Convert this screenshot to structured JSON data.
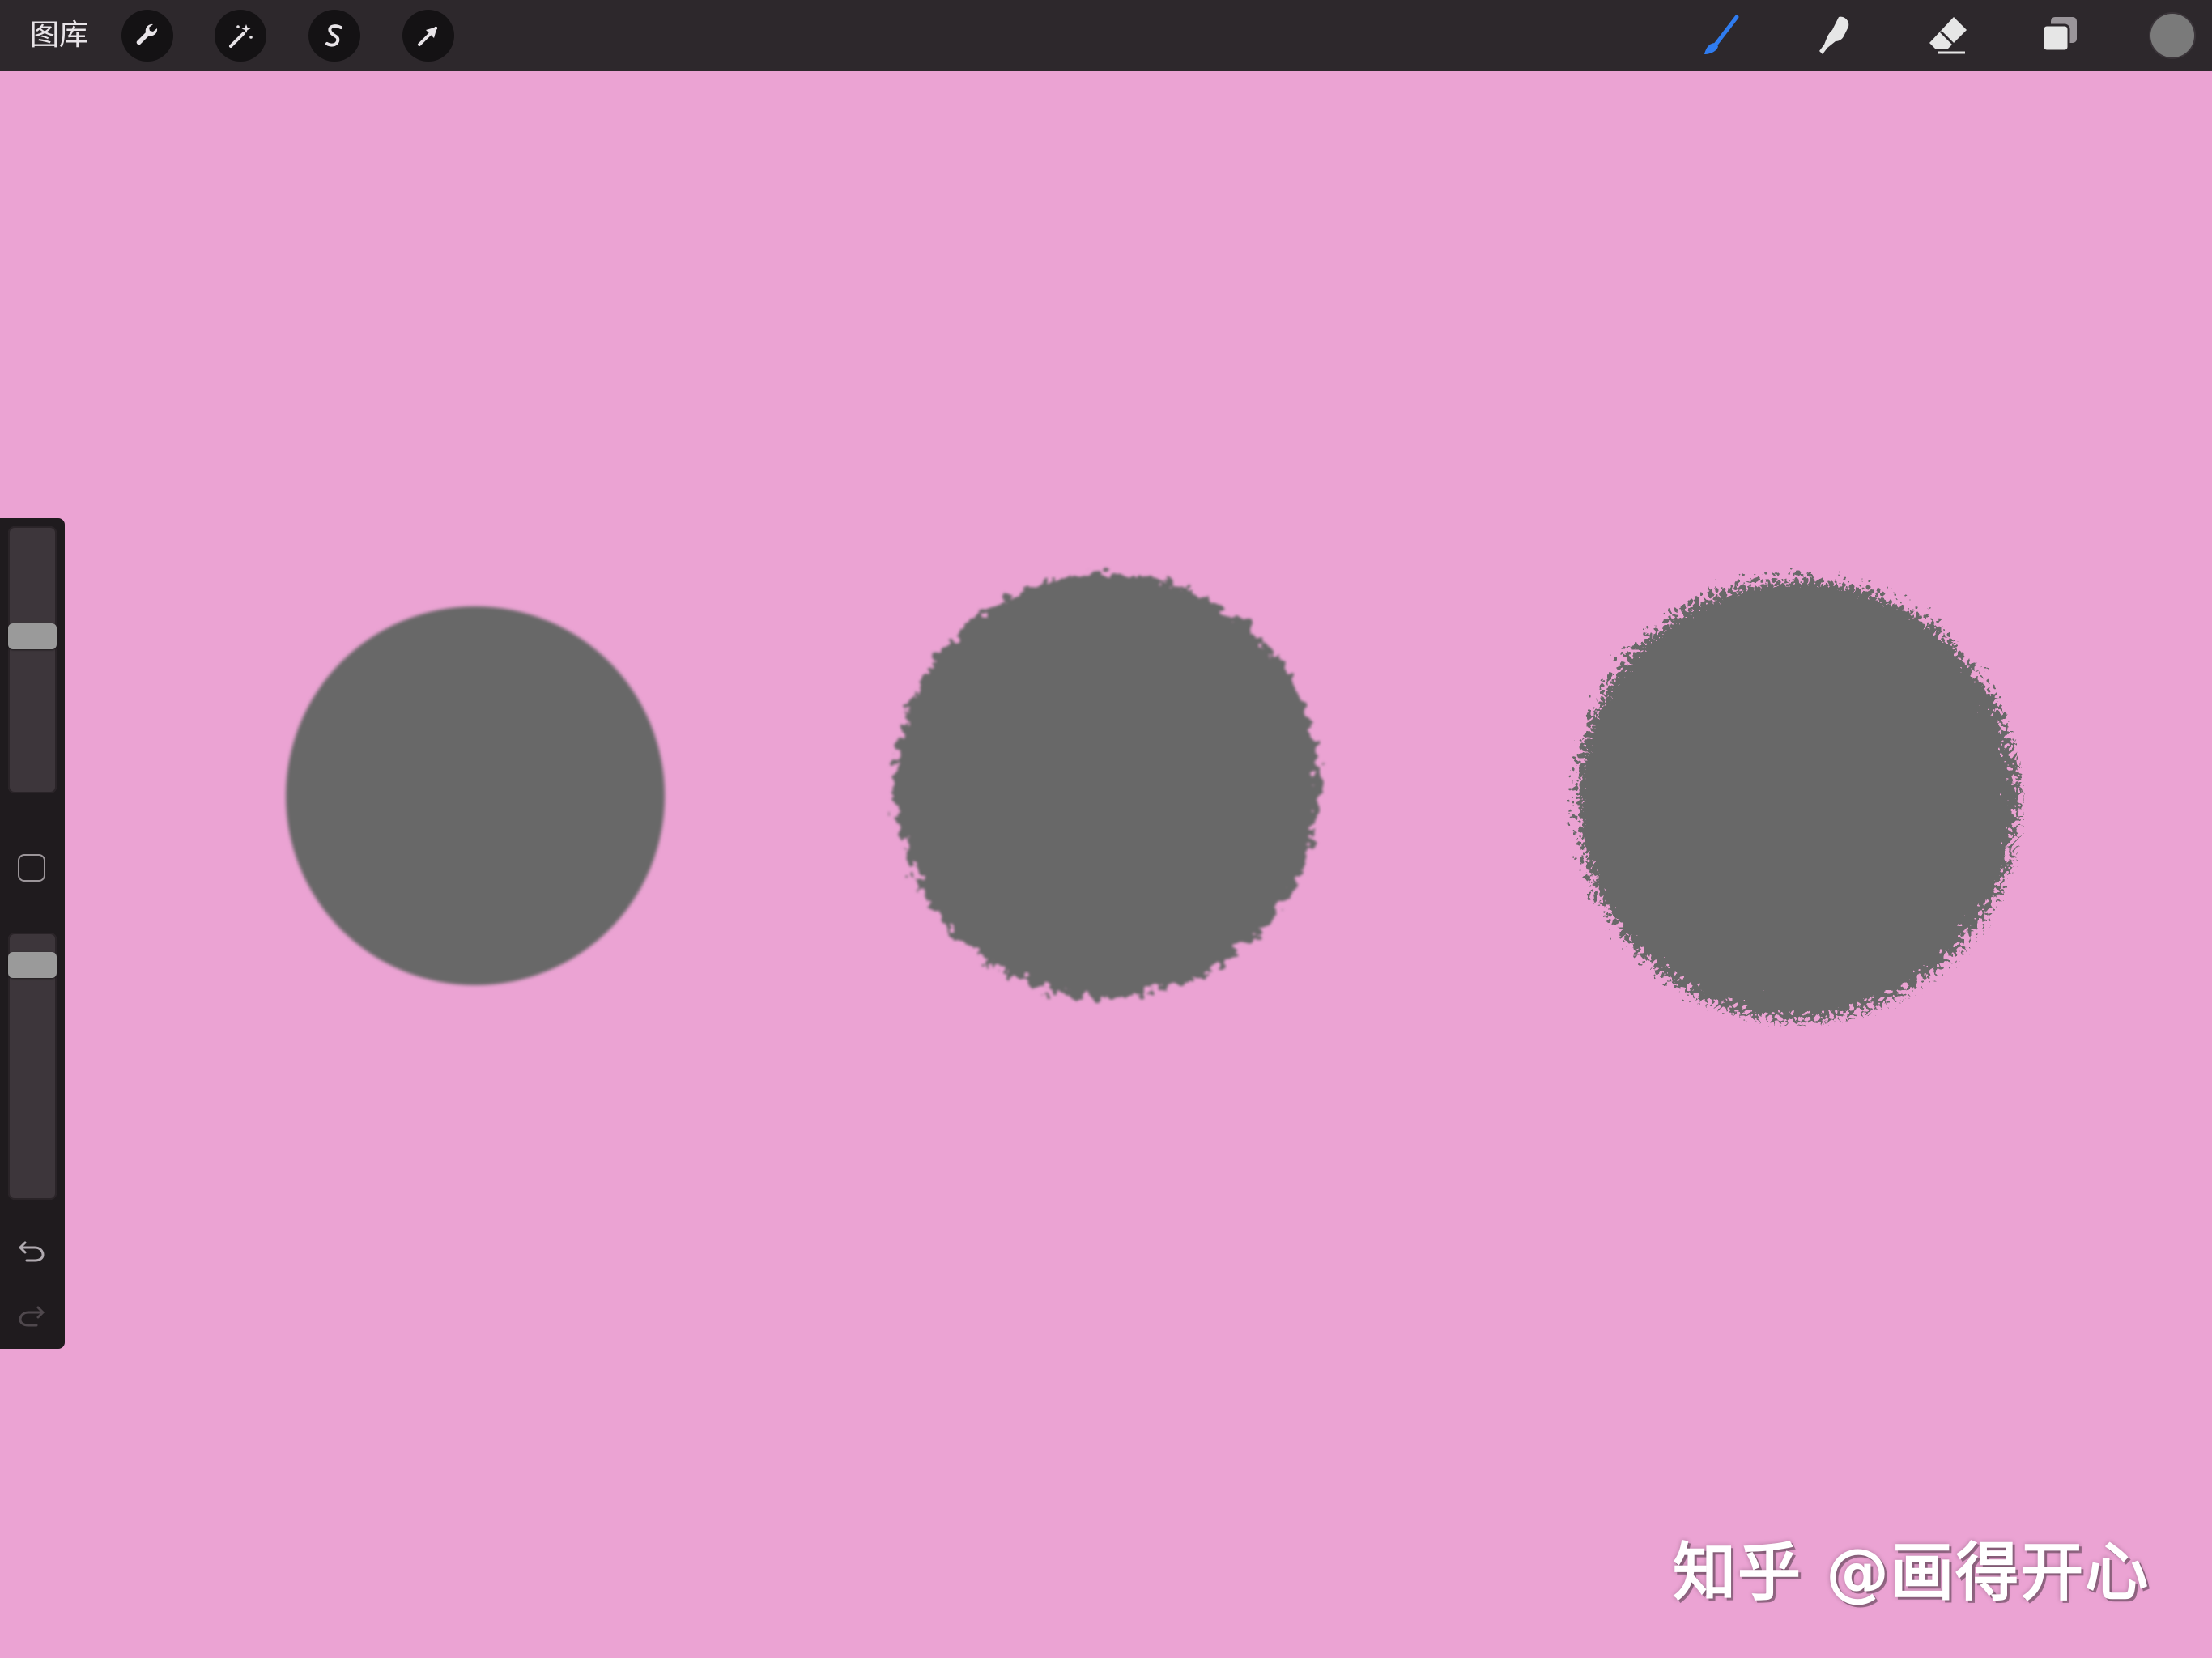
{
  "topbar": {
    "gallery_label": "图库",
    "adv_tools": [
      {
        "name": "wrench-icon"
      },
      {
        "name": "magic-wand-icon"
      },
      {
        "name": "selection-s-icon"
      },
      {
        "name": "transform-arrow-icon"
      }
    ],
    "tools": [
      {
        "name": "brush-icon",
        "active": true,
        "color": "#2f7cf0"
      },
      {
        "name": "smudge-icon",
        "active": false,
        "color": "#e6e6e6"
      },
      {
        "name": "eraser-icon",
        "active": false,
        "color": "#e6e6e6"
      },
      {
        "name": "layers-icon",
        "active": false,
        "color": "#e6e6e6"
      }
    ],
    "current_color": "#7a7a7a"
  },
  "canvas": {
    "background": "#eba3d3",
    "stroke_color": "#686868"
  },
  "sidebar": {
    "size_level": 0.6,
    "opacity_level": 0.93,
    "undo_icon": "undo-icon",
    "redo_icon": "redo-icon"
  },
  "watermark": "知乎 @画得开心"
}
